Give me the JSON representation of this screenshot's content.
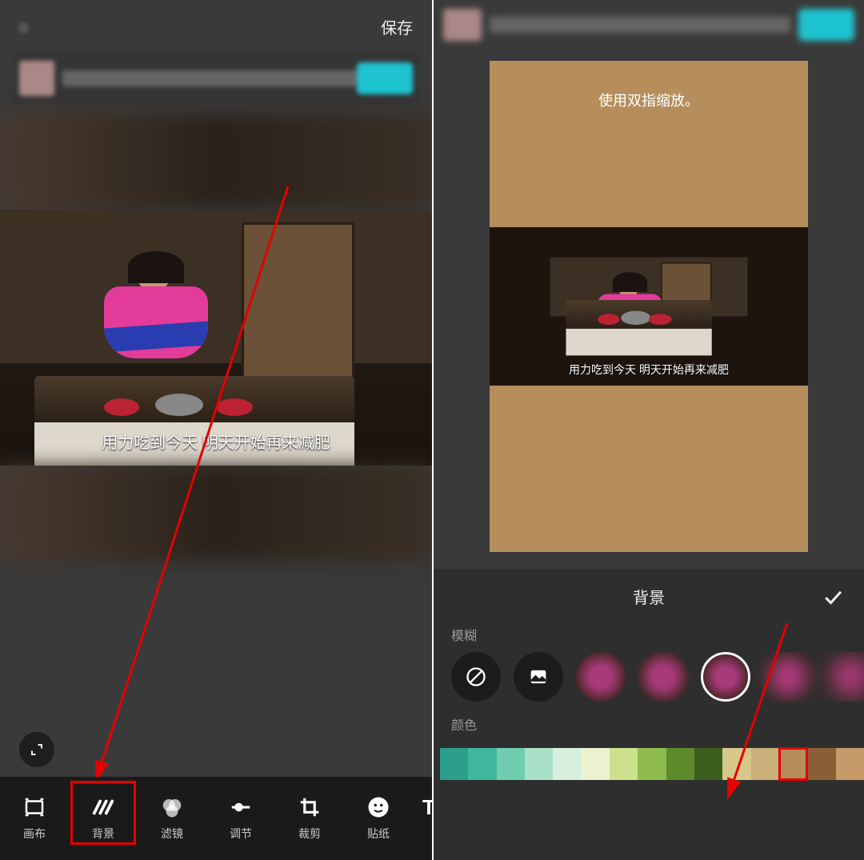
{
  "left": {
    "save_label": "保存",
    "subtitle": "用力吃到今天  明天开始再来减肥",
    "tools": [
      {
        "id": "canvas",
        "label": "画布"
      },
      {
        "id": "bg",
        "label": "背景",
        "selected": true
      },
      {
        "id": "filter",
        "label": "滤镜"
      },
      {
        "id": "adjust",
        "label": "调节"
      },
      {
        "id": "crop",
        "label": "裁剪"
      },
      {
        "id": "sticker",
        "label": "贴纸"
      },
      {
        "id": "text",
        "label": "文"
      }
    ]
  },
  "right": {
    "hint": "使用双指缩放。",
    "subtitle": "用力吃到今天  明天开始再来减肥",
    "panel_title": "背景",
    "section_blur": "模糊",
    "section_color": "颜色",
    "blur_items": [
      {
        "id": "none"
      },
      {
        "id": "gallery"
      },
      {
        "id": "b1"
      },
      {
        "id": "b2"
      },
      {
        "id": "b3",
        "selected": true
      },
      {
        "id": "b4"
      },
      {
        "id": "b5"
      }
    ],
    "colors": [
      "#2b9e8c",
      "#3fb79c",
      "#70cdb1",
      "#a8e0c8",
      "#d7f0de",
      "#eef2d0",
      "#cde08d",
      "#8fbb4d",
      "#5d8a2a",
      "#3d5f1e",
      "#d8c78a",
      "#c9b079",
      "#b58e5c",
      "#8a5f35",
      "#c79a6a"
    ],
    "selected_color_index": 12
  }
}
